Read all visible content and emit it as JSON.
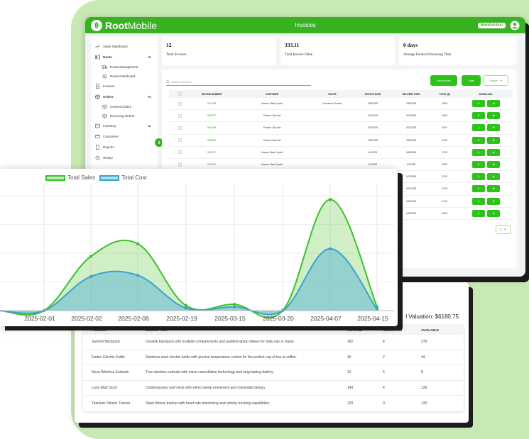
{
  "header": {
    "logo": "RootMobile",
    "logo_main": "Root",
    "logo_light": "Mobile",
    "title": "Invoices",
    "brand_badge_main": "Root",
    "brand_badge_light": "Mobile"
  },
  "sidebar": {
    "items": [
      {
        "label": "Sales Dashboard",
        "icon": "trend-icon"
      },
      {
        "label": "Route",
        "icon": "route-icon"
      },
      {
        "label": "Route Management",
        "icon": "truck-icon"
      },
      {
        "label": "Route Dashboard",
        "icon": "map-pin-icon"
      },
      {
        "label": "Invoices",
        "icon": "invoice-icon"
      },
      {
        "label": "Orders",
        "icon": "box-icon"
      },
      {
        "label": "Current Orders",
        "icon": "box-icon"
      },
      {
        "label": "Recurring Orders",
        "icon": "box-icon"
      },
      {
        "label": "Inventory",
        "icon": "inventory-icon"
      },
      {
        "label": "Customers",
        "icon": "customers-icon"
      },
      {
        "label": "Reports",
        "icon": "report-icon"
      },
      {
        "label": "History",
        "icon": "history-icon"
      }
    ]
  },
  "stats": {
    "total_invoices": {
      "value": "12",
      "label": "Total Invoices"
    },
    "total_value": {
      "value": "333.11",
      "label": "Total Invoice Value"
    },
    "processing_time": {
      "value": "0 days",
      "label": "Average Invoice Processing Time"
    }
  },
  "invoices": {
    "search_placeholder": "Search Invoices",
    "new_invoice_label": "New Invoice",
    "clear_label": "Clear",
    "options_label": "Options",
    "pager_label": "10",
    "columns": [
      "INVOICE NUMBER",
      "CUSTOMER",
      "ROUTE",
      "INVOICE DATE",
      "DELIVERY DATE",
      "TOTAL ($)",
      "DOWNLOAD"
    ],
    "rows": [
      {
        "number": "2021208",
        "customer": "Arizona State Capitol",
        "route": "Downtown Phoenix",
        "invoice_date": "2/28/2025",
        "delivery_date": "2/28/2025",
        "total": "18.99"
      },
      {
        "number": "0005297",
        "customer": "Phoenix City Hall",
        "route": "",
        "invoice_date": "3/13/2025",
        "delivery_date": "3/13/2025",
        "total": "18.99"
      },
      {
        "number": "0005298",
        "customer": "Phoenix City Hall",
        "route": "",
        "invoice_date": "3/13/2025",
        "delivery_date": "3/13/2025",
        "total": "9.69"
      },
      {
        "number": "0005303",
        "customer": "Phoenix City Hall",
        "route": "",
        "invoice_date": "3/28/2025",
        "delivery_date": "3/28/2025",
        "total": "17.69"
      },
      {
        "number": "0005317",
        "customer": "Arizona State Capitol",
        "route": "",
        "invoice_date": "4/4/2025",
        "delivery_date": "4/30/2025",
        "total": "17.69"
      },
      {
        "number": "0005317",
        "customer": "Arizona State Capitol",
        "route": "",
        "invoice_date": "4/4/2025",
        "delivery_date": "4/4/2025",
        "total": "35.33"
      },
      {
        "number": "",
        "customer": "",
        "route": "",
        "invoice_date": "",
        "delivery_date": "4/22/2025",
        "total": "17.69"
      },
      {
        "number": "",
        "customer": "",
        "route": "",
        "invoice_date": "",
        "delivery_date": "4/22/2025",
        "total": "17.69"
      },
      {
        "number": "",
        "customer": "",
        "route": "",
        "invoice_date": "",
        "delivery_date": "4/22/2025",
        "total": "17.69"
      },
      {
        "number": "",
        "customer": "",
        "route": "",
        "invoice_date": "",
        "delivery_date": "4/22/2025",
        "total": "18.49"
      }
    ]
  },
  "products": {
    "valuation_label": "l Valuation: $6180.75",
    "columns": [
      "PRODUCT",
      "DESCRIPTION",
      "ON HAND",
      "ALLOCATED",
      "AVAILABLE"
    ],
    "rows": [
      {
        "product": "Summit Backpack",
        "description": "Durable backpack with multiple compartments and padded laptop sleeve for daily use or travel.",
        "on_hand": "282",
        "allocated": "4",
        "available": "278"
      },
      {
        "product": "Ember Electric Kettle",
        "description": "Stainless steel electric kettle with precise temperature control for the perfect cup of tea or coffee.",
        "on_hand": "46",
        "allocated": "2",
        "available": "44"
      },
      {
        "product": "Nova Wireless Earbuds",
        "description": "True wireless earbuds with noise-cancellation technology and long-lasting battery.",
        "on_hand": "12",
        "allocated": "4",
        "available": "8"
      },
      {
        "product": "Luna Wall Clock",
        "description": "Contemporary wall clock with silent sweep movement and minimalist design.",
        "on_hand": "143",
        "allocated": "4",
        "available": "139"
      },
      {
        "product": "Titanium Fitness Tracker",
        "description": "Sleek fitness tracker with heart rate monitoring and activity tracking capabilities.",
        "on_hand": "120",
        "allocated": "0",
        "available": "120"
      }
    ]
  },
  "chart_data": {
    "type": "area",
    "x": [
      "2025-02-01",
      "2025-02-02",
      "2025-02-08",
      "2025-02-19",
      "2025-03-15",
      "2025-03-20",
      "2025-04-07",
      "2025-04-15"
    ],
    "series": [
      {
        "name": "Total Sales",
        "color": "#3cc22a",
        "values": [
          0,
          43,
          53,
          4,
          5,
          0,
          88,
          3
        ]
      },
      {
        "name": "Total Cost",
        "color": "#3aa3d0",
        "values": [
          0,
          27,
          28,
          2,
          3,
          0,
          49,
          1
        ]
      }
    ],
    "ylim": [
      0,
      100
    ],
    "grid": true,
    "legend": "top-left"
  }
}
